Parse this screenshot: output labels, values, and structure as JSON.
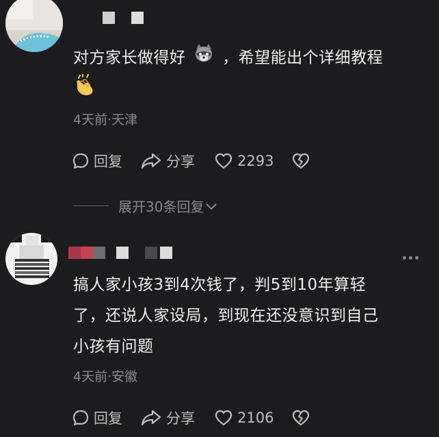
{
  "comments": [
    {
      "text_line1": "对方家长做得好",
      "text_line1_b": "，希望能出个详细教程",
      "meta": "4天前·天津",
      "reply_label": "回复",
      "share_label": "分享",
      "like_count": "2293"
    },
    {
      "text_line1": "搞人家小孩3到4次钱了，判5到10年算轻",
      "text_line2": "了，还说人家设局，到现在还没意识到自己",
      "text_line3": "小孩有问题",
      "meta": "4天前·安徽",
      "reply_label": "回复",
      "share_label": "分享",
      "like_count": "2106"
    }
  ],
  "expand_replies": "展开30条回复",
  "colors": {
    "background": "#1c1c1e",
    "text": "#eeeeee",
    "muted": "#8a8a8e"
  },
  "icons": [
    "comment-bubble-icon",
    "share-arrow-icon",
    "heart-icon",
    "broken-heart-icon",
    "raccoon-emoji",
    "clapping-hands-emoji",
    "chevron-down-icon",
    "more-dots-icon"
  ]
}
